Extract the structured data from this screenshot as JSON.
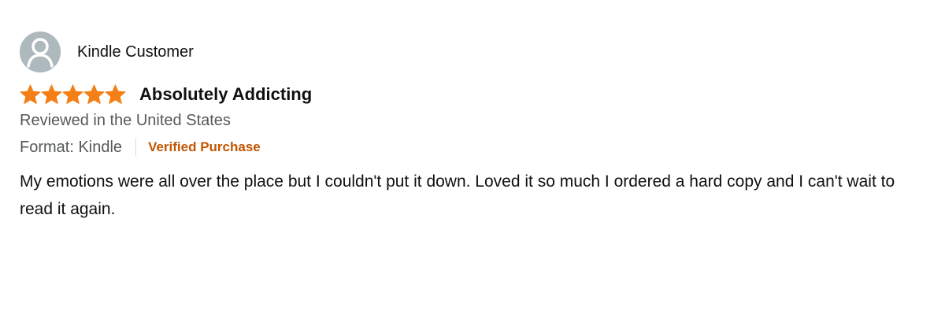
{
  "reviewer": {
    "name": "Kindle Customer",
    "avatar_icon": "person-silhouette-icon"
  },
  "rating": {
    "stars": 5,
    "max_stars": 5,
    "star_color": "#f47f16",
    "star_icon": "star-icon"
  },
  "review": {
    "title": "Absolutely Addicting",
    "origin": "Reviewed in the United States",
    "format": "Format: Kindle",
    "verified": "Verified Purchase",
    "body": "My emotions were all over the place but I couldn't put it down. Loved it so much I ordered a hard copy and I can't wait to read it again."
  },
  "colors": {
    "verified": "#c45500",
    "secondary_text": "#565959",
    "primary_text": "#0f1111"
  }
}
